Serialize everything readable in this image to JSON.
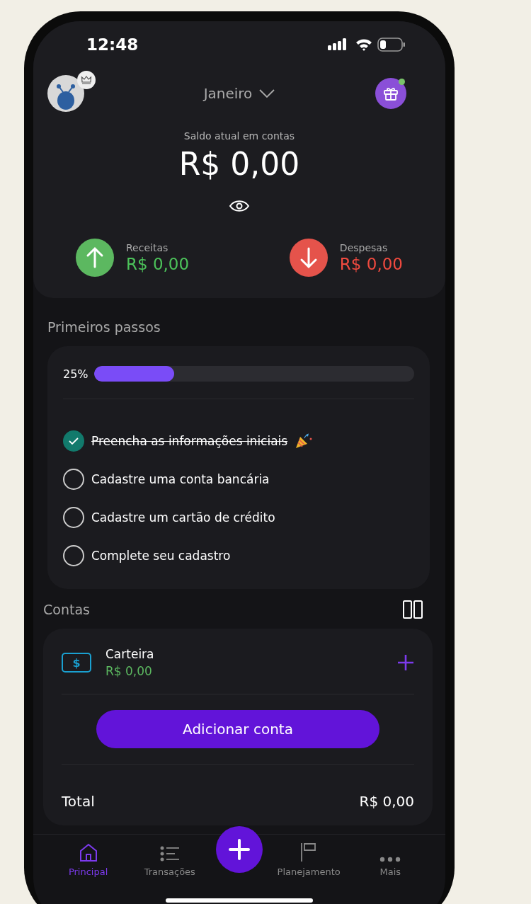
{
  "status_bar": {
    "time": "12:48"
  },
  "header": {
    "month": "Janeiro"
  },
  "balance": {
    "label": "Saldo atual em contas",
    "amount": "R$ 0,00"
  },
  "summary": [
    {
      "kind": "income",
      "label": "Receitas",
      "amount": "R$ 0,00"
    },
    {
      "kind": "expense",
      "label": "Despesas",
      "amount": "R$ 0,00"
    }
  ],
  "onboarding": {
    "title": "Primeiros passos",
    "progress_label": "25%",
    "level": 0.25,
    "steps": [
      {
        "label": "Preencha as informações iniciais",
        "checked": true
      },
      {
        "label": "Cadastre uma conta bancária",
        "checked": false
      },
      {
        "label": "Cadastre um cartão de crédito",
        "checked": false
      },
      {
        "label": "Complete seu cadastro",
        "checked": false
      }
    ]
  },
  "accounts": {
    "title": "Contas",
    "items": [
      {
        "icon_glyph": "$",
        "name": "Carteira",
        "balance": "R$ 0,00"
      }
    ],
    "add_button": "Adicionar conta",
    "total_label": "Total",
    "total_value": "R$ 0,00"
  },
  "nav": {
    "items": [
      {
        "kind": "home",
        "label": "Principal",
        "selected": true
      },
      {
        "kind": "list",
        "label": "Transações",
        "selected": false
      },
      {
        "kind": "fab"
      },
      {
        "kind": "flag",
        "label": "Planejamento",
        "selected": false
      },
      {
        "kind": "more",
        "label": "Mais",
        "selected": false
      }
    ]
  }
}
